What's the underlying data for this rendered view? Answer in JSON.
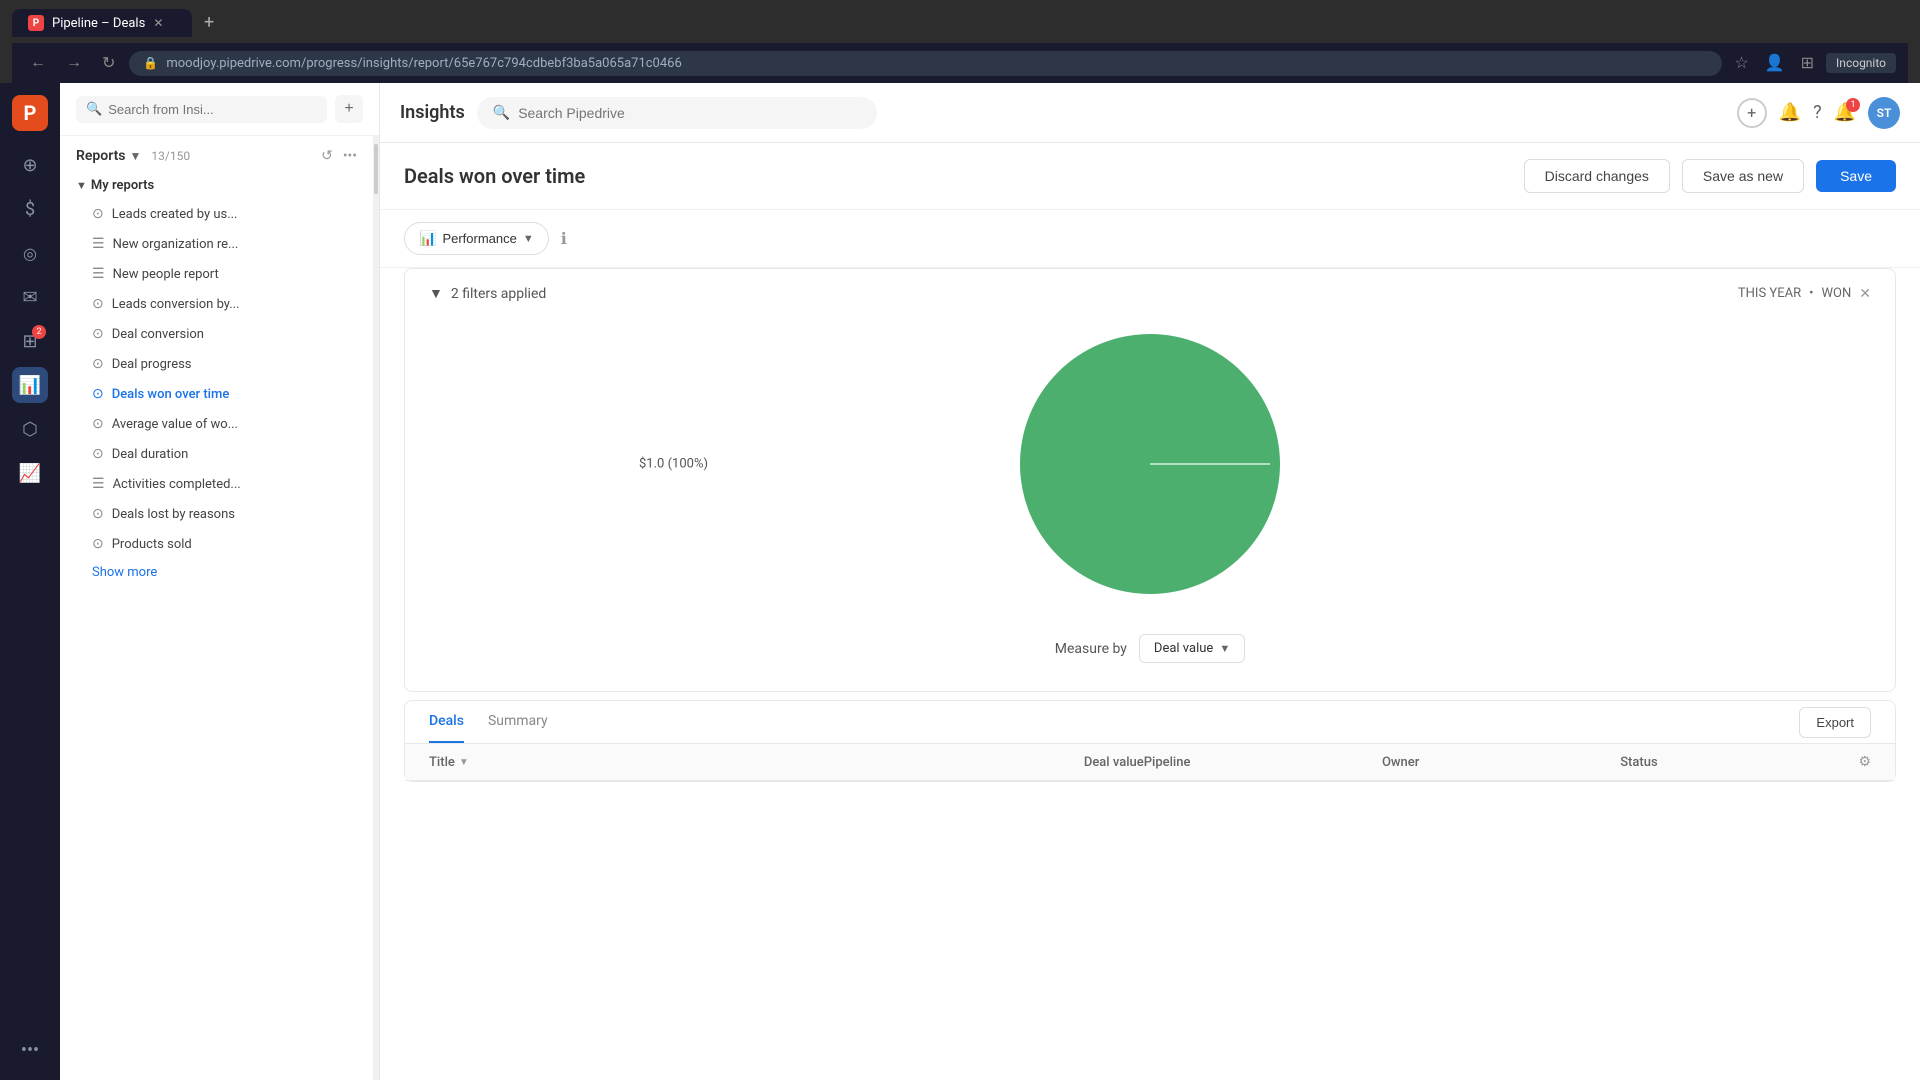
{
  "browser": {
    "tab_title": "Pipeline – Deals",
    "tab_favicon": "P",
    "address": "moodjoy.pipedrive.com/progress/insights/report/65e767c794cdbebf3ba5a065a71c0466",
    "incognito_label": "Incognito"
  },
  "topbar": {
    "app_title": "Insights",
    "search_placeholder": "Search Pipedrive",
    "add_icon": "+",
    "notification_count": "1",
    "avatar_initials": "ST"
  },
  "sidebar": {
    "search_placeholder": "Search from Insi...",
    "reports_label": "Reports",
    "reports_count": "13/150",
    "my_reports_label": "My reports",
    "items": [
      {
        "id": "leads-created",
        "label": "Leads created by us...",
        "icon": "⊙",
        "active": false
      },
      {
        "id": "new-org",
        "label": "New organization re...",
        "icon": "☰",
        "active": false
      },
      {
        "id": "new-people",
        "label": "New people report",
        "icon": "☰",
        "active": false
      },
      {
        "id": "leads-conversion",
        "label": "Leads conversion by...",
        "icon": "⊙",
        "active": false
      },
      {
        "id": "deal-conversion",
        "label": "Deal conversion",
        "icon": "⊙",
        "active": false
      },
      {
        "id": "deal-progress",
        "label": "Deal progress",
        "icon": "⊙",
        "active": false
      },
      {
        "id": "deals-won",
        "label": "Deals won over time",
        "icon": "⊙",
        "active": true
      },
      {
        "id": "avg-value",
        "label": "Average value of wo...",
        "icon": "⊙",
        "active": false
      },
      {
        "id": "deal-duration",
        "label": "Deal duration",
        "icon": "⊙",
        "active": false
      },
      {
        "id": "activities",
        "label": "Activities completed...",
        "icon": "☰",
        "active": false
      },
      {
        "id": "deals-lost",
        "label": "Deals lost by reasons",
        "icon": "⊙",
        "active": false
      },
      {
        "id": "products-sold",
        "label": "Products sold",
        "icon": "⊙",
        "active": false
      }
    ],
    "show_more_label": "Show more"
  },
  "report": {
    "title": "Deals won over time",
    "discard_label": "Discard changes",
    "save_new_label": "Save as new",
    "save_label": "Save",
    "performance_label": "Performance",
    "filters_applied": "2 filters applied",
    "date_filter": "THIS YEAR",
    "status_filter": "WON",
    "measure_by_label": "Measure by",
    "deal_value_label": "Deal value",
    "pie_label": "$1.0 (100%)",
    "pie_color": "#4caf6e",
    "chart_note": ""
  },
  "table": {
    "tabs": [
      "Deals",
      "Summary"
    ],
    "active_tab": "Deals",
    "export_label": "Export",
    "columns": [
      "Title",
      "Deal value",
      "Pipeline",
      "Owner",
      "Status"
    ]
  },
  "rail": {
    "icons": [
      {
        "id": "home",
        "symbol": "⊕",
        "active": false
      },
      {
        "id": "deals",
        "symbol": "$",
        "active": false
      },
      {
        "id": "leads",
        "symbol": "◎",
        "active": false
      },
      {
        "id": "mail",
        "symbol": "✉",
        "active": false
      },
      {
        "id": "calendar",
        "symbol": "⊞",
        "badge": "2"
      },
      {
        "id": "reports",
        "symbol": "⬛",
        "active": true
      },
      {
        "id": "products",
        "symbol": "⬡",
        "active": false
      },
      {
        "id": "analytics",
        "symbol": "⊞",
        "active": false
      }
    ]
  }
}
